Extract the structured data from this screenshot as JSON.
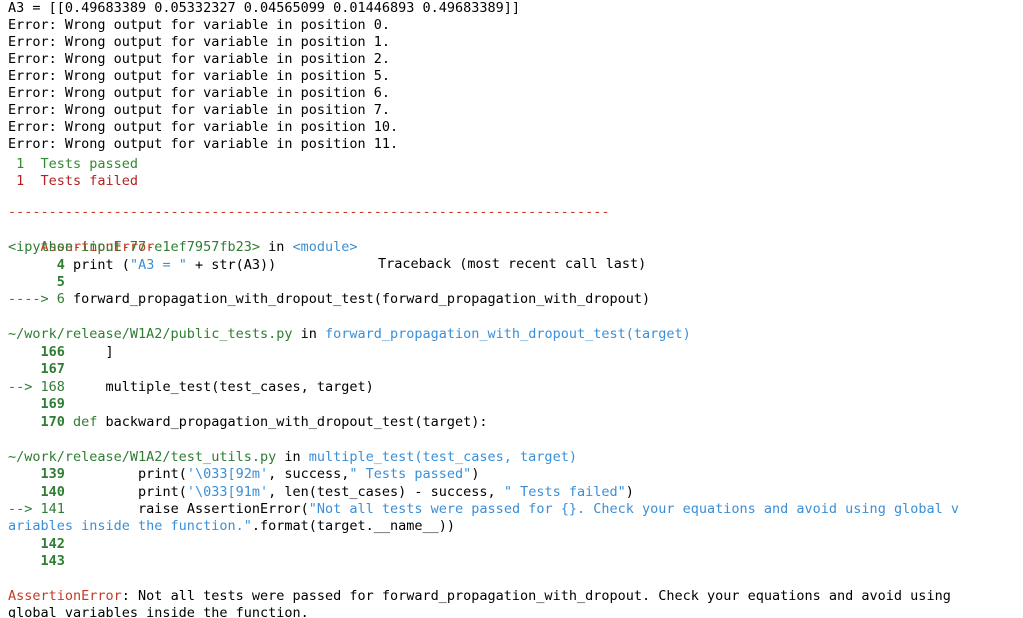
{
  "header_line": "A3 = [[0.49683389 0.05332327 0.04565099 0.01446893 0.49683389]]",
  "errors": [
    "Error: Wrong output for variable in position 0.",
    "Error: Wrong output for variable in position 1.",
    "Error: Wrong output for variable in position 2.",
    "Error: Wrong output for variable in position 5.",
    "Error: Wrong output for variable in position 6.",
    "Error: Wrong output for variable in position 7.",
    "Error: Wrong output for variable in position 10.",
    "Error: Wrong output for variable in position 11."
  ],
  "summary": {
    "passed": " 1  Tests passed",
    "failed": " 1  Tests failed"
  },
  "dash_line": "--------------------------------------------------------------------------",
  "traceback": {
    "error_name": "AssertionError",
    "title": "Traceback (most recent call last)",
    "frame1": {
      "location": "<ipython-input-77-e1ef7957fb23>",
      "in": " in ",
      "func": "<module>",
      "lines": [
        {
          "num": "      4",
          "code_a": " print (",
          "code_str": "\"A3 = \"",
          "code_b": " + str(A3))"
        },
        {
          "num": "      5",
          "code_a": "",
          "code_str": "",
          "code_b": ""
        }
      ],
      "arrow_num": "----> 6",
      "arrow_code": " forward_propagation_with_dropout_test(forward_propagation_with_dropout)"
    },
    "frame2": {
      "path": "~/work/release/W1A2/public_tests.py",
      "in": " in ",
      "func": "forward_propagation_with_dropout_test(target)",
      "l166_num": "    166",
      "l166_code": "     ]",
      "l167_num": "    167",
      "arrow_num": "--> 168",
      "arrow_code": "     multiple_test(test_cases, target)",
      "l169_num": "    169",
      "l170_num": "    170",
      "l170_kw": " def",
      "l170_code": " backward_propagation_with_dropout_test(target):"
    },
    "frame3": {
      "path": "~/work/release/W1A2/test_utils.py",
      "in": " in ",
      "func": "multiple_test(test_cases, target)",
      "l139_num": "    139",
      "l139_a": "         print(",
      "l139_s1": "'\\033[92m'",
      "l139_b": ", success,",
      "l139_s2": "\" Tests passed\"",
      "l139_c": ")",
      "l140_num": "    140",
      "l140_a": "         print(",
      "l140_s1": "'\\033[91m'",
      "l140_b": ", len(test_cases) - success, ",
      "l140_s2": "\" Tests failed\"",
      "l140_c": ")",
      "arrow_num": "--> 141",
      "arrow_a": "         raise AssertionError(",
      "arrow_s1": "\"Not all tests were passed for {}. Check your equations and avoid using global v",
      "wrap_s": "ariables inside the function.\"",
      "wrap_b": ".format(target.__name__))",
      "l142_num": "    142",
      "l143_num": "    143"
    },
    "final_error_name": "AssertionError",
    "final_msg_1": ": Not all tests were passed for forward_propagation_with_dropout. Check your equations and avoid using",
    "final_msg_2": "global variables inside the function."
  }
}
